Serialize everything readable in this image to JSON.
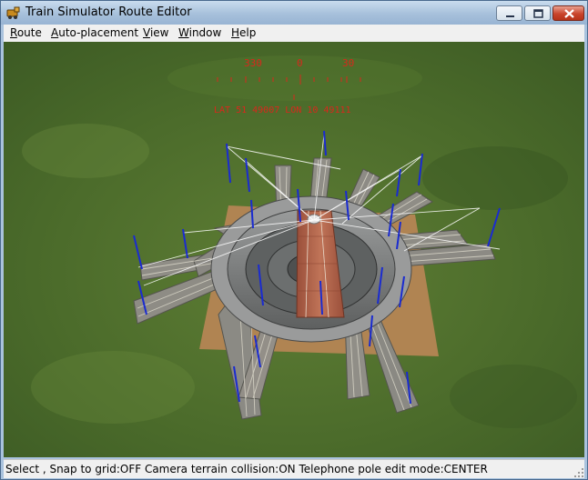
{
  "window": {
    "title": "Train Simulator Route Editor"
  },
  "menu": {
    "items": [
      {
        "label": "Route",
        "accel": "R",
        "rest": "oute"
      },
      {
        "label": "Auto-placement",
        "accel": "A",
        "rest": "uto-placement"
      },
      {
        "label": "View",
        "accel": "V",
        "rest": "iew"
      },
      {
        "label": "Window",
        "accel": "W",
        "rest": "indow"
      },
      {
        "label": "Help",
        "accel": "H",
        "rest": "elp"
      }
    ]
  },
  "compass": {
    "heading_left": "330",
    "heading_center": "0",
    "heading_right": "30",
    "coords": "LAT 51 49007 LON 10 49111"
  },
  "status": {
    "text": "Select , Snap to grid:OFF Camera terrain collision:ON Telephone pole edit mode:CENTER"
  },
  "colors": {
    "hud": "#d8281c",
    "track_bed": "#8a8a84",
    "pit": "#7a7c7c",
    "turntable_bridge": "#b0624a",
    "marker_blue": "#1a2bd0",
    "terrain": "#4d6a2a"
  }
}
